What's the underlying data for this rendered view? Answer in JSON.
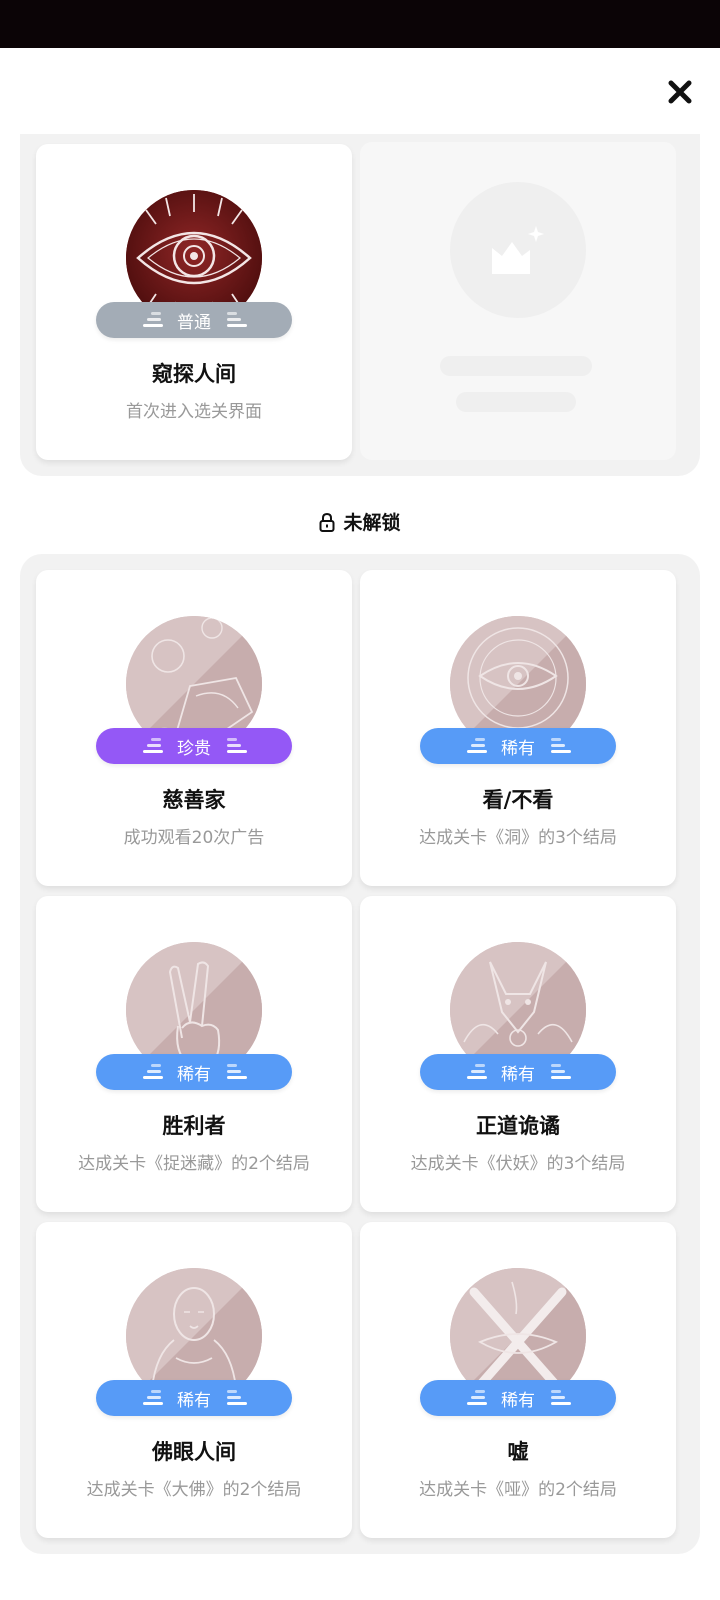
{
  "header": {
    "close_icon": "close-icon"
  },
  "unlocked": {
    "items": [
      {
        "title": "窥探人间",
        "desc": "首次进入选关界面",
        "badge": "普通",
        "badge_color": "#a3acb6",
        "art": "eye"
      }
    ]
  },
  "locked": {
    "label": "未解锁",
    "lock_icon": "lock-icon",
    "items": [
      {
        "title": "慈善家",
        "desc": "成功观看20次广告",
        "badge": "珍贵",
        "badge_color": "#9458f6",
        "art": "money"
      },
      {
        "title": "看/不看",
        "desc": "达成关卡《洞》的3个结局",
        "badge": "稀有",
        "badge_color": "#579bf7",
        "art": "eye-ring"
      },
      {
        "title": "胜利者",
        "desc": "达成关卡《捉迷藏》的2个结局",
        "badge": "稀有",
        "badge_color": "#579bf7",
        "art": "victory-hand"
      },
      {
        "title": "正道诡谲",
        "desc": "达成关卡《伏妖》的3个结局",
        "badge": "稀有",
        "badge_color": "#579bf7",
        "art": "fox"
      },
      {
        "title": "佛眼人间",
        "desc": "达成关卡《大佛》的2个结局",
        "badge": "稀有",
        "badge_color": "#579bf7",
        "art": "buddha"
      },
      {
        "title": "嘘",
        "desc": "达成关卡《哑》的2个结局",
        "badge": "稀有",
        "badge_color": "#579bf7",
        "art": "crossed-mouth"
      }
    ]
  }
}
